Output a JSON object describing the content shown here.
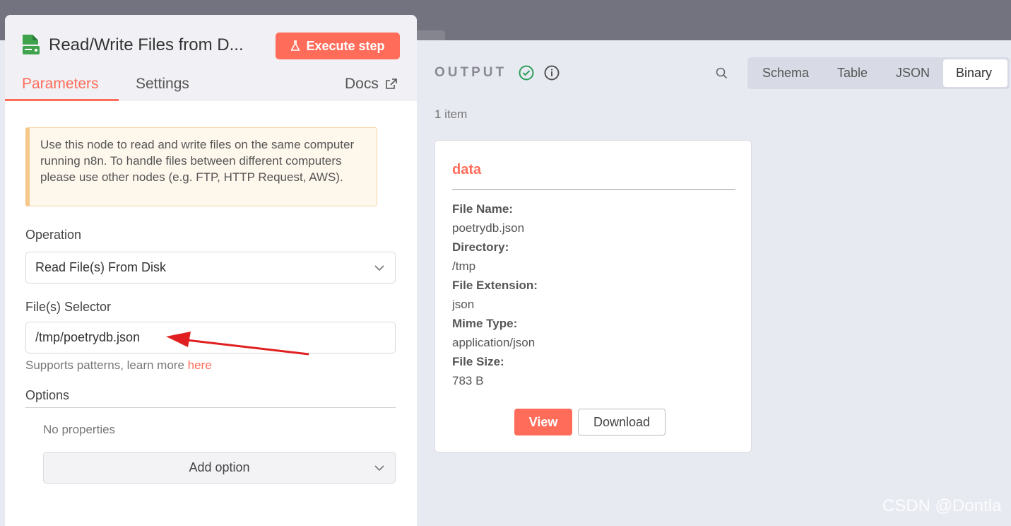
{
  "panel": {
    "title": "Read/Write Files from D...",
    "execute_label": "Execute step",
    "tabs": [
      {
        "label": "Parameters",
        "active": true
      },
      {
        "label": "Settings",
        "active": false
      }
    ],
    "docs_label": "Docs",
    "notice": "Use this node to read and write files on the same computer running n8n. To handle files between different computers please use other nodes (e.g. FTP, HTTP Request, AWS).",
    "operation": {
      "label": "Operation",
      "value": "Read File(s) From Disk"
    },
    "selector": {
      "label": "File(s) Selector",
      "value": "/tmp/poetrydb.json"
    },
    "hint": {
      "text": "Supports patterns, learn more ",
      "link": "here"
    },
    "options": {
      "label": "Options",
      "empty_text": "No properties",
      "add_label": "Add option"
    }
  },
  "output": {
    "title": "OUTPUT",
    "tabs": [
      "Schema",
      "Table",
      "JSON",
      "Binary"
    ],
    "active_tab": "Binary",
    "item_count": "1 item",
    "card": {
      "title": "data",
      "fields": [
        {
          "key": "File Name:",
          "value": "poetrydb.json"
        },
        {
          "key": "Directory:",
          "value": "/tmp"
        },
        {
          "key": "File Extension:",
          "value": "json"
        },
        {
          "key": "Mime Type:",
          "value": "application/json"
        },
        {
          "key": "File Size:",
          "value": "783 B"
        }
      ],
      "view_label": "View",
      "download_label": "Download"
    }
  },
  "watermark": "CSDN @Dontla",
  "colors": {
    "accent": "#ff6d5a",
    "success": "#2e9e5b",
    "arrow": "#e02020"
  }
}
